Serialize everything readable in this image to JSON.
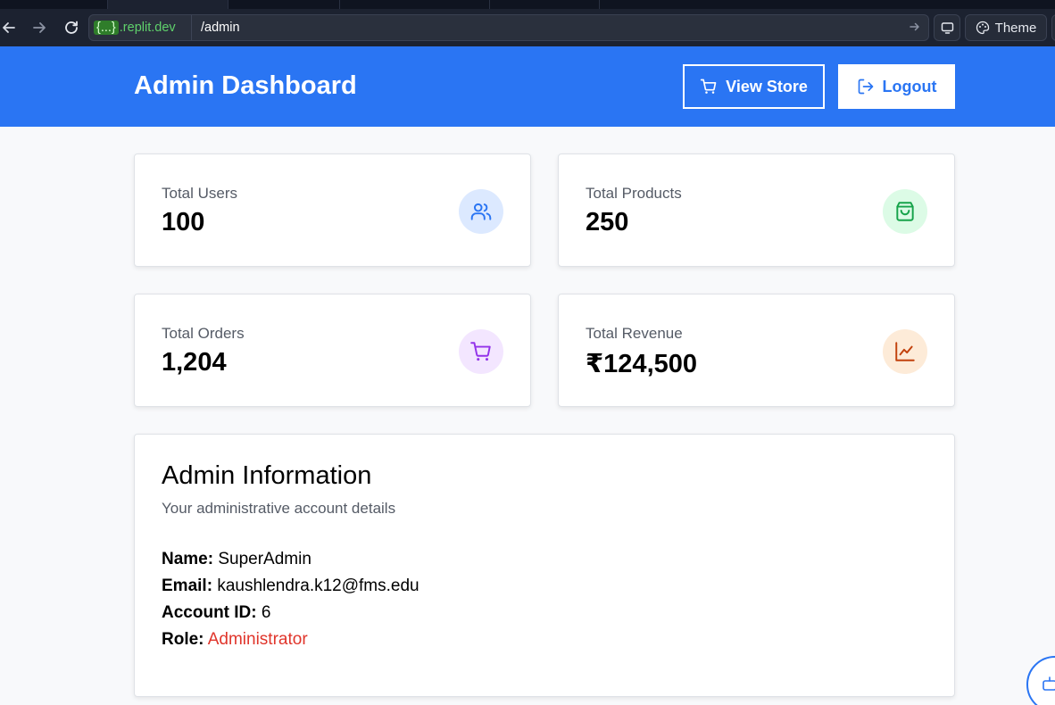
{
  "browser": {
    "url_host_brace": "{...}",
    "url_host_domain": ".replit.dev",
    "url_path": "/admin",
    "theme_label": "Theme"
  },
  "header": {
    "title": "Admin Dashboard",
    "view_store_label": "View Store",
    "logout_label": "Logout",
    "accent_color": "#2a75f3"
  },
  "stats": [
    {
      "label": "Total Users",
      "value": "100",
      "icon": "users-icon",
      "icon_bg": "#dce9ff",
      "icon_color": "#2a75f3"
    },
    {
      "label": "Total Products",
      "value": "250",
      "icon": "shopping-bag-icon",
      "icon_bg": "#dcfbe6",
      "icon_color": "#16a34a"
    },
    {
      "label": "Total Orders",
      "value": "1,204",
      "icon": "shopping-cart-icon",
      "icon_bg": "#f3e6ff",
      "icon_color": "#9333ea"
    },
    {
      "label": "Total Revenue",
      "value": "₹124,500",
      "icon": "line-chart-icon",
      "icon_bg": "#fdebd8",
      "icon_color": "#c2410c"
    }
  ],
  "admin_info": {
    "title": "Admin Information",
    "subtitle": "Your administrative account details",
    "rows": [
      {
        "label": "Name:",
        "value": "SuperAdmin"
      },
      {
        "label": "Email:",
        "value": "kaushlendra.k12@fms.edu"
      },
      {
        "label": "Account ID:",
        "value": "6"
      },
      {
        "label": "Role:",
        "value": "Administrator"
      }
    ],
    "role_color": "#e0352b"
  }
}
